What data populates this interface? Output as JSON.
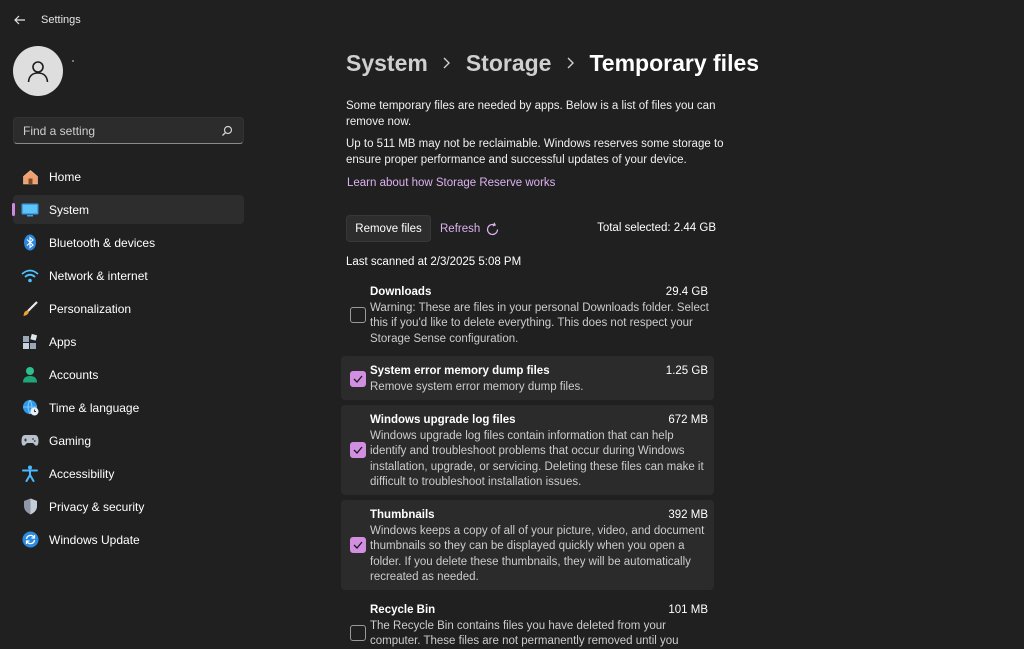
{
  "app": {
    "title": "Settings"
  },
  "search": {
    "placeholder": "Find a setting"
  },
  "sidebar": {
    "items": [
      {
        "label": "Home",
        "icon": "home-icon"
      },
      {
        "label": "System",
        "icon": "system-icon",
        "selected": true
      },
      {
        "label": "Bluetooth & devices",
        "icon": "bluetooth-icon"
      },
      {
        "label": "Network & internet",
        "icon": "wifi-icon"
      },
      {
        "label": "Personalization",
        "icon": "brush-icon"
      },
      {
        "label": "Apps",
        "icon": "apps-icon"
      },
      {
        "label": "Accounts",
        "icon": "accounts-icon"
      },
      {
        "label": "Time & language",
        "icon": "globe-clock-icon"
      },
      {
        "label": "Gaming",
        "icon": "gamepad-icon"
      },
      {
        "label": "Accessibility",
        "icon": "accessibility-icon"
      },
      {
        "label": "Privacy & security",
        "icon": "shield-icon"
      },
      {
        "label": "Windows Update",
        "icon": "update-icon"
      }
    ]
  },
  "breadcrumb": {
    "items": [
      "System",
      "Storage",
      "Temporary files"
    ]
  },
  "main": {
    "desc1": "Some temporary files are needed by apps. Below is a list of files you can remove now.",
    "desc2": "Up to 511 MB may not be reclaimable. Windows reserves some storage to ensure proper performance and successful updates of your device.",
    "link": "Learn about how Storage Reserve works",
    "remove_button": "Remove files",
    "refresh_label": "Refresh",
    "total_selected": "Total selected: 2.44 GB",
    "last_scanned": "Last scanned at 2/3/2025 5:08 PM"
  },
  "files": [
    {
      "name": "Downloads",
      "size": "29.4 GB",
      "checked": false,
      "description": "Warning: These are files in your personal Downloads folder. Select this if you'd like to delete everything. This does not respect your Storage Sense configuration."
    },
    {
      "name": "System error memory dump files",
      "size": "1.25 GB",
      "checked": true,
      "description": "Remove system error memory dump files."
    },
    {
      "name": "Windows upgrade log files",
      "size": "672 MB",
      "checked": true,
      "description": "Windows upgrade log files contain information that can help identify and troubleshoot problems that occur during Windows installation, upgrade, or servicing.  Deleting these files can make it difficult to troubleshoot installation issues."
    },
    {
      "name": "Thumbnails",
      "size": "392 MB",
      "checked": true,
      "description": "Windows keeps a copy of all of your picture, video, and document thumbnails so they can be displayed quickly when you open a folder. If you delete these thumbnails, they will be automatically recreated as needed."
    },
    {
      "name": "Recycle Bin",
      "size": "101 MB",
      "checked": false,
      "description": "The Recycle Bin contains files you have deleted from your computer. These files are not permanently removed until you"
    }
  ],
  "colors": {
    "accent": "#d28fe2",
    "link": "#dcb1f0",
    "background": "#202020",
    "selected_bg": "#2d2d2d"
  }
}
